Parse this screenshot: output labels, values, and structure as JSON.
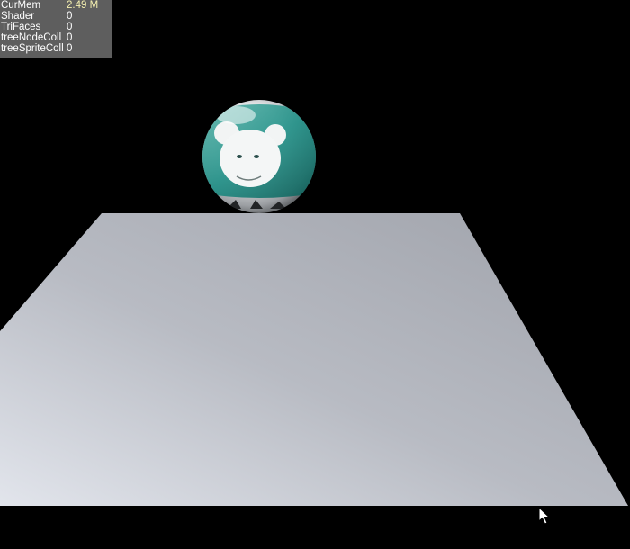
{
  "stats": [
    {
      "label": "CurMem",
      "value": "2.49 M",
      "value_color": "#f5f0b0"
    },
    {
      "label": "Shader",
      "value": "0",
      "value_color": "#ffffff"
    },
    {
      "label": "TriFaces",
      "value": "0",
      "value_color": "#ffffff"
    },
    {
      "label": "treeNodeColl",
      "value": "0",
      "value_color": "#ffffff"
    },
    {
      "label": "treeSpriteColl",
      "value": "0",
      "value_color": "#ffffff"
    }
  ],
  "scene": {
    "background_color": "#000000",
    "plane_colors": [
      "#dde0e6",
      "#a3a6ae"
    ],
    "ball_colors": [
      "#ffffff",
      "#1f8f86"
    ]
  },
  "cursor": {
    "icon": "arrow-cursor-icon"
  }
}
